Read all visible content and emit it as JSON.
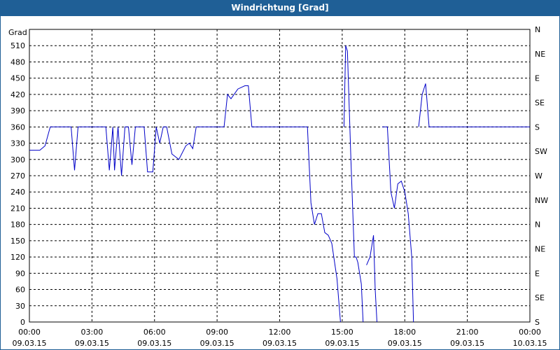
{
  "window": {
    "title": "Windrichtung [Grad]"
  },
  "chart_data": {
    "type": "line",
    "title": "Windrichtung [Grad]",
    "ylabel": "Grad",
    "xlabel": "",
    "xlim": [
      "2015-03-09 00:00",
      "2015-03-10 00:00"
    ],
    "ylim": [
      0,
      540
    ],
    "yticks": [
      0,
      30,
      60,
      90,
      120,
      150,
      180,
      210,
      240,
      270,
      300,
      330,
      360,
      390,
      420,
      450,
      480,
      510
    ],
    "y2ticks": [
      "S",
      "SE",
      "E",
      "NE",
      "N",
      "NW",
      "W",
      "SW",
      "S",
      "SE",
      "E",
      "NE",
      "N"
    ],
    "xticks": [
      {
        "time": "00:00",
        "date": "09.03.15"
      },
      {
        "time": "03:00",
        "date": "09.03.15"
      },
      {
        "time": "06:00",
        "date": "09.03.15"
      },
      {
        "time": "09:00",
        "date": "09.03.15"
      },
      {
        "time": "12:00",
        "date": "09.03.15"
      },
      {
        "time": "15:00",
        "date": "09.03.15"
      },
      {
        "time": "18:00",
        "date": "09.03.15"
      },
      {
        "time": "21:00",
        "date": "09.03.15"
      },
      {
        "time": "00:00",
        "date": "10.03.15"
      }
    ],
    "grid": true,
    "colors": {
      "line": "#0000c8",
      "titlebar": "#1f5f96"
    },
    "series": [
      {
        "segments": [
          [
            [
              "00:00",
              317
            ],
            [
              "00:30",
              317
            ],
            [
              "00:45",
              325
            ],
            [
              "01:00",
              360
            ],
            [
              "02:00",
              360
            ],
            [
              "02:10",
              280
            ],
            [
              "02:20",
              360
            ],
            [
              "03:40",
              360
            ],
            [
              "03:50",
              280
            ],
            [
              "04:00",
              360
            ],
            [
              "04:05",
              280
            ],
            [
              "04:15",
              360
            ],
            [
              "04:25",
              270
            ],
            [
              "04:35",
              360
            ],
            [
              "04:45",
              360
            ],
            [
              "04:55",
              290
            ],
            [
              "05:05",
              360
            ],
            [
              "05:30",
              360
            ],
            [
              "05:40",
              277
            ],
            [
              "05:55",
              277
            ],
            [
              "06:05",
              360
            ],
            [
              "06:15",
              330
            ],
            [
              "06:25",
              360
            ],
            [
              "06:35",
              360
            ],
            [
              "06:50",
              310
            ],
            [
              "07:10",
              300
            ],
            [
              "07:30",
              325
            ],
            [
              "07:40",
              330
            ],
            [
              "07:50",
              320
            ],
            [
              "08:00",
              360
            ],
            [
              "09:20",
              360
            ],
            [
              "09:30",
              420
            ],
            [
              "09:40",
              412
            ],
            [
              "10:00",
              430
            ],
            [
              "10:20",
              436
            ],
            [
              "10:30",
              436
            ],
            [
              "10:40",
              360
            ],
            [
              "13:20",
              360
            ],
            [
              "13:30",
              220
            ],
            [
              "13:40",
              180
            ],
            [
              "13:50",
              200
            ],
            [
              "14:00",
              200
            ],
            [
              "14:10",
              165
            ],
            [
              "14:20",
              160
            ],
            [
              "14:30",
              145
            ],
            [
              "14:45",
              80
            ],
            [
              "14:55",
              0
            ]
          ],
          [
            [
              "15:05",
              360
            ],
            [
              "15:10",
              510
            ],
            [
              "15:15",
              500
            ],
            [
              "15:25",
              300
            ],
            [
              "15:35",
              120
            ],
            [
              "15:40",
              120
            ],
            [
              "15:45",
              110
            ],
            [
              "15:55",
              70
            ],
            [
              "16:00",
              0
            ]
          ],
          [
            [
              "16:10",
              105
            ],
            [
              "16:20",
              120
            ],
            [
              "16:30",
              160
            ],
            [
              "16:35",
              60
            ],
            [
              "16:40",
              0
            ]
          ],
          [
            [
              "16:55",
              360
            ],
            [
              "17:10",
              360
            ],
            [
              "17:20",
              240
            ],
            [
              "17:30",
              210
            ],
            [
              "17:40",
              255
            ],
            [
              "17:50",
              260
            ],
            [
              "18:00",
              240
            ],
            [
              "18:10",
              200
            ],
            [
              "18:20",
              120
            ],
            [
              "18:25",
              0
            ]
          ],
          [
            [
              "18:40",
              360
            ],
            [
              "18:50",
              420
            ],
            [
              "19:00",
              440
            ],
            [
              "19:10",
              360
            ],
            [
              "24:00",
              360
            ]
          ]
        ]
      }
    ]
  }
}
